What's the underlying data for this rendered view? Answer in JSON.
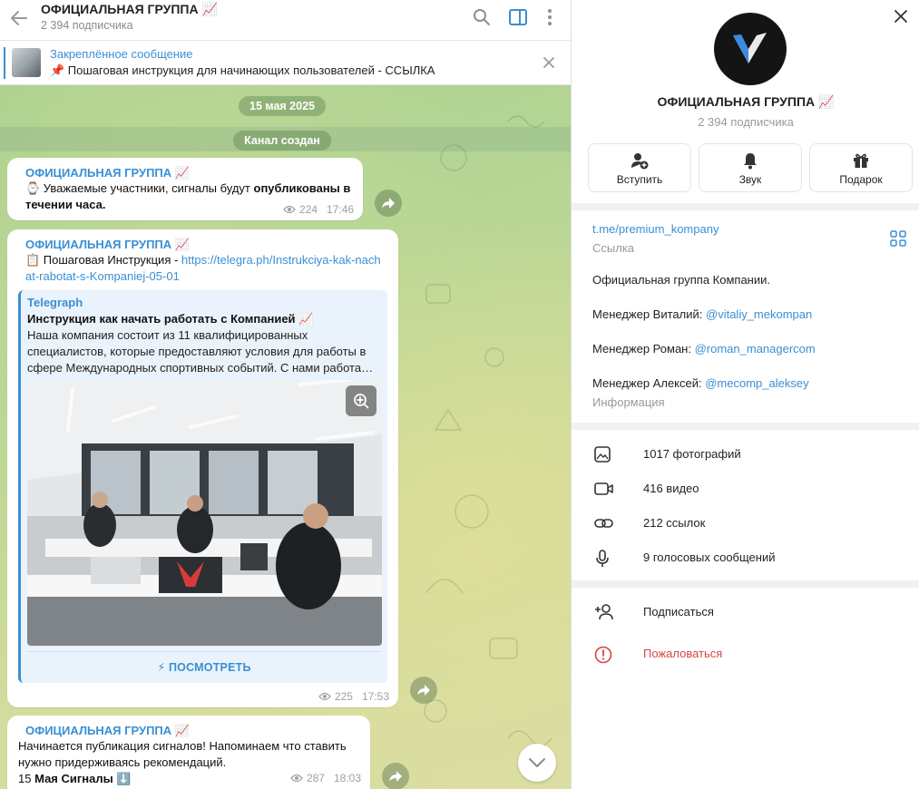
{
  "chat": {
    "title": "ОФИЦИАЛЬНАЯ ГРУППА 📈",
    "subscribers": "2 394 подписчика",
    "pinned": {
      "title": "Закреплённое сообщение",
      "text": "📌 Пошаговая инструкция для начинающих пользователей - ССЫЛКА"
    },
    "date_chip": "15 мая 2025",
    "service_chip": "Канал создан",
    "messages": [
      {
        "author": "ОФИЦИАЛЬНАЯ ГРУППА 📈",
        "text_plain": "⌚ Уважаемые участники, сигналы будут ",
        "text_bold": "опубликованы в течении часа.",
        "views": "224",
        "time": "17:46"
      },
      {
        "author": "ОФИЦИАЛЬНАЯ ГРУППА 📈",
        "text_plain": "📋 Пошаговая Инструкция - ",
        "link": "https://telegra.ph/Instrukciya-kak-nachat-rabotat-s-Kompaniej-05-01",
        "preview": {
          "site": "Telegraph",
          "title": "Инструкция как начать работать с Компанией 📈",
          "description": "Наша компания состоит из 11 квалифицированных специалистов, которые предоставляют условия для работы в сфере Международных спортивных событий. С нами работа…",
          "button": "⚡ ПОСМОТРЕТЬ"
        },
        "views": "225",
        "time": "17:53"
      },
      {
        "author": "ОФИЦИАЛЬНАЯ ГРУППА 📈",
        "text_plain": "Начинается публикация сигналов! Напоминаем что ставить нужно придерживаясь рекомендаций.",
        "line2_plain": "15 ",
        "line2_bold": "Мая Сигналы",
        "line2_emoji": " ⬇️",
        "views": "287",
        "time": "18:03"
      }
    ]
  },
  "panel": {
    "name": "ОФИЦИАЛЬНАЯ ГРУППА 📈",
    "subscribers": "2 394 подписчика",
    "actions": [
      {
        "label": "Вступить",
        "icon": "add-user-icon"
      },
      {
        "label": "Звук",
        "icon": "bell-icon"
      },
      {
        "label": "Подарок",
        "icon": "gift-icon"
      }
    ],
    "link": "t.me/premium_kompany",
    "link_caption": "Ссылка",
    "description": "Официальная группа Компании.",
    "managers": [
      {
        "label": "Менеджер Виталий: ",
        "handle": "@vitaliy_mekompan"
      },
      {
        "label": "Менеджер Роман: ",
        "handle": "@roman_managercom"
      },
      {
        "label": "Менеджер Алексей: ",
        "handle": "@mecomp_aleksey"
      }
    ],
    "info_caption": "Информация",
    "media": [
      {
        "label": "1017 фотографий",
        "icon": "photo-icon"
      },
      {
        "label": "416 видео",
        "icon": "video-icon"
      },
      {
        "label": "212 ссылок",
        "icon": "link-icon"
      },
      {
        "label": "9 голосовых сообщений",
        "icon": "microphone-icon"
      }
    ],
    "subscribe": "Подписаться",
    "report": "Пожаловаться",
    "accent": "#3a8fd4",
    "danger": "#d64545"
  }
}
